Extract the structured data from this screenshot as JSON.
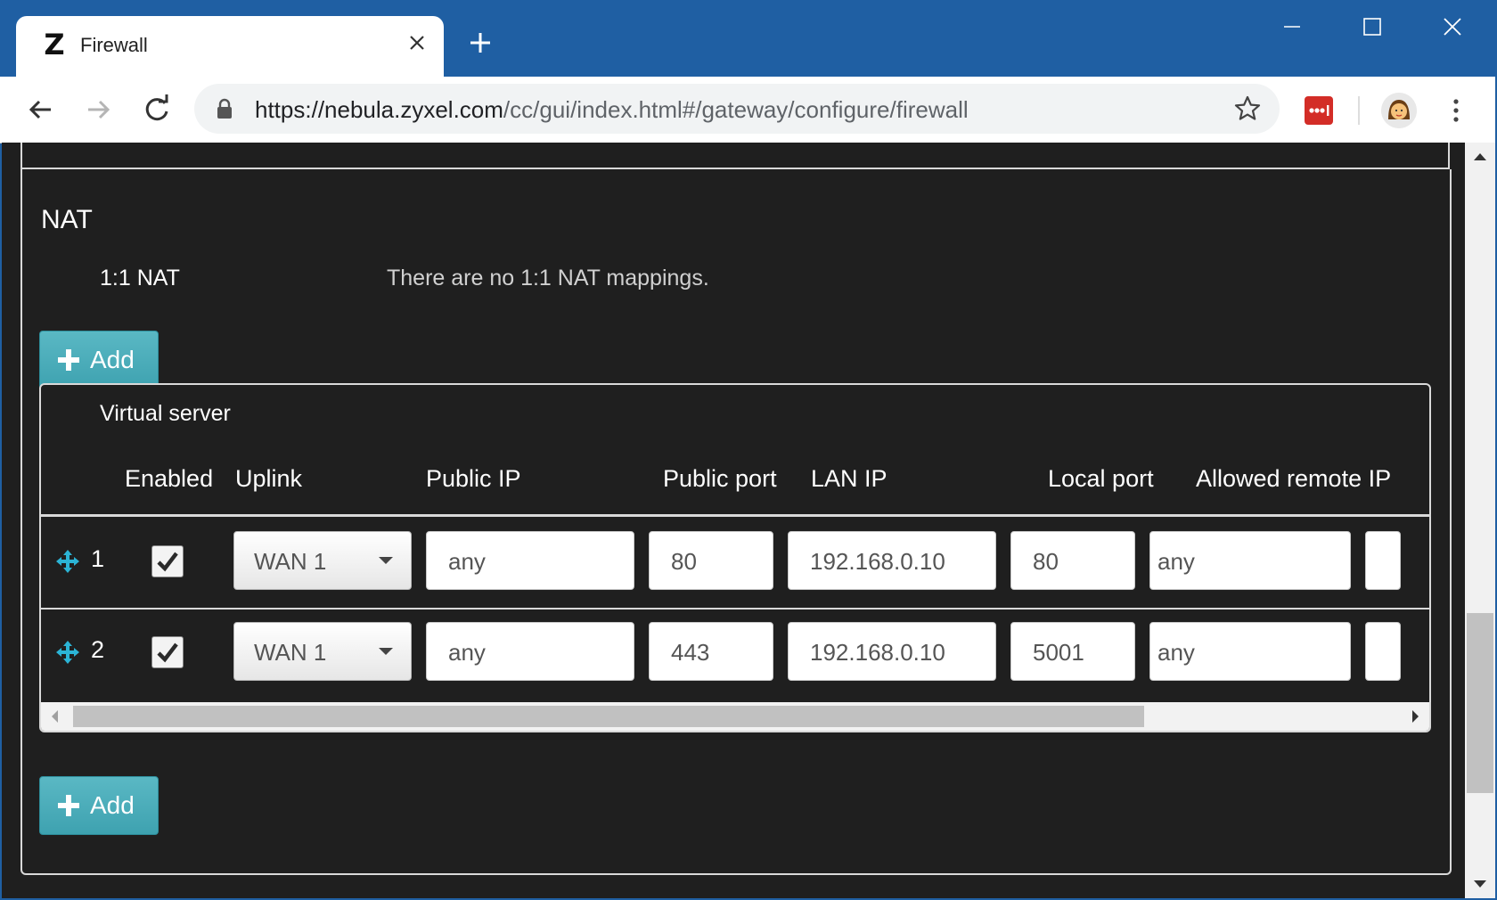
{
  "browser": {
    "tab_title": "Firewall",
    "tab_favicon": "Z",
    "url_host": "https://nebula.zyxel.com",
    "url_path": "/cc/gui/index.html#/gateway/configure/firewall"
  },
  "nat": {
    "title": "NAT",
    "one_to_one_label": "1:1 NAT",
    "one_to_one_value": "There are no 1:1 NAT mappings.",
    "add_label": "Add"
  },
  "virtual_server": {
    "title": "Virtual server",
    "columns": [
      "Enabled",
      "Uplink",
      "Public IP",
      "Public port",
      "LAN IP",
      "Local port",
      "Allowed remote IP"
    ],
    "rows": [
      {
        "num": "1",
        "enabled": true,
        "uplink": "WAN 1",
        "public_ip": "any",
        "public_port": "80",
        "lan_ip": "192.168.0.10",
        "local_port": "80",
        "allowed_remote_ip": "any"
      },
      {
        "num": "2",
        "enabled": true,
        "uplink": "WAN 1",
        "public_ip": "any",
        "public_port": "443",
        "lan_ip": "192.168.0.10",
        "local_port": "5001",
        "allowed_remote_ip": "any"
      }
    ],
    "add_label": "Add"
  },
  "colors": {
    "titlebar": "#1f5fa3",
    "content_bg": "#1f1f1f",
    "add_button": "#4aaab8",
    "move_icon": "#2bb4d6"
  },
  "icons": [
    "zyxel-logo-icon",
    "close-tab-icon",
    "new-tab-icon",
    "minimize-icon",
    "maximize-icon",
    "close-window-icon",
    "back-icon",
    "forward-icon",
    "reload-icon",
    "lock-icon",
    "star-icon",
    "lastpass-icon",
    "avatar-icon",
    "menu-icon",
    "plus-icon",
    "move-icon",
    "checkmark-icon",
    "dropdown-caret-icon"
  ]
}
